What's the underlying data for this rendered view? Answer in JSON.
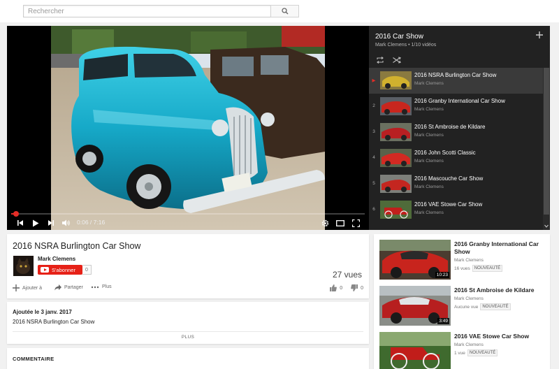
{
  "search": {
    "placeholder": "Rechercher"
  },
  "player": {
    "time": "0:06 / 7:16",
    "progress_fraction": 0.0138
  },
  "playlist": {
    "title": "2016 Car Show",
    "subtitle": "Mark Clemens • 1/10 vidéos",
    "items": [
      {
        "index": "▶",
        "title": "2016 NSRA Burlington Car Show",
        "owner": "Mark Clemens"
      },
      {
        "index": "2",
        "title": "2016 Granby International Car Show",
        "owner": "Mark Clemens"
      },
      {
        "index": "3",
        "title": "2016 St Ambroise de Kildare",
        "owner": "Mark Clemens"
      },
      {
        "index": "4",
        "title": "2016 John Scotti Classic",
        "owner": "Mark Clemens"
      },
      {
        "index": "5",
        "title": "2016 Mascouche Car Show",
        "owner": "Mark Clemens"
      },
      {
        "index": "6",
        "title": "2016 VAE Stowe Car Show",
        "owner": "Mark Clemens"
      }
    ]
  },
  "video": {
    "title": "2016 NSRA Burlington Car Show",
    "channel": "Mark Clemens",
    "subscribe_label": "S'abonner",
    "subscriber_count": "0",
    "views": "27 vues",
    "add_label": "Ajouter à",
    "share_label": "Partager",
    "more_label": "Plus",
    "likes": "0",
    "dislikes": "0"
  },
  "description": {
    "date": "Ajoutée le 3 janv. 2017",
    "text": "2016 NSRA Burlington Car Show",
    "more": "PLUS"
  },
  "comments": {
    "label": "COMMENTAIRE"
  },
  "related": [
    {
      "title": "2016 Granby International Car Show",
      "owner": "Mark Clemens",
      "views": "16 vues",
      "badge": "NOUVEAUTÉ",
      "duration": "10:23"
    },
    {
      "title": "2016 St Ambroise de Kildare",
      "owner": "Mark Clemens",
      "views": "Aucune vue",
      "badge": "NOUVEAUTÉ",
      "duration": "3:49"
    },
    {
      "title": "2016 VAE Stowe Car Show",
      "owner": "Mark Clemens",
      "views": "1 vue",
      "badge": "NOUVEAUTÉ",
      "duration": ""
    }
  ]
}
